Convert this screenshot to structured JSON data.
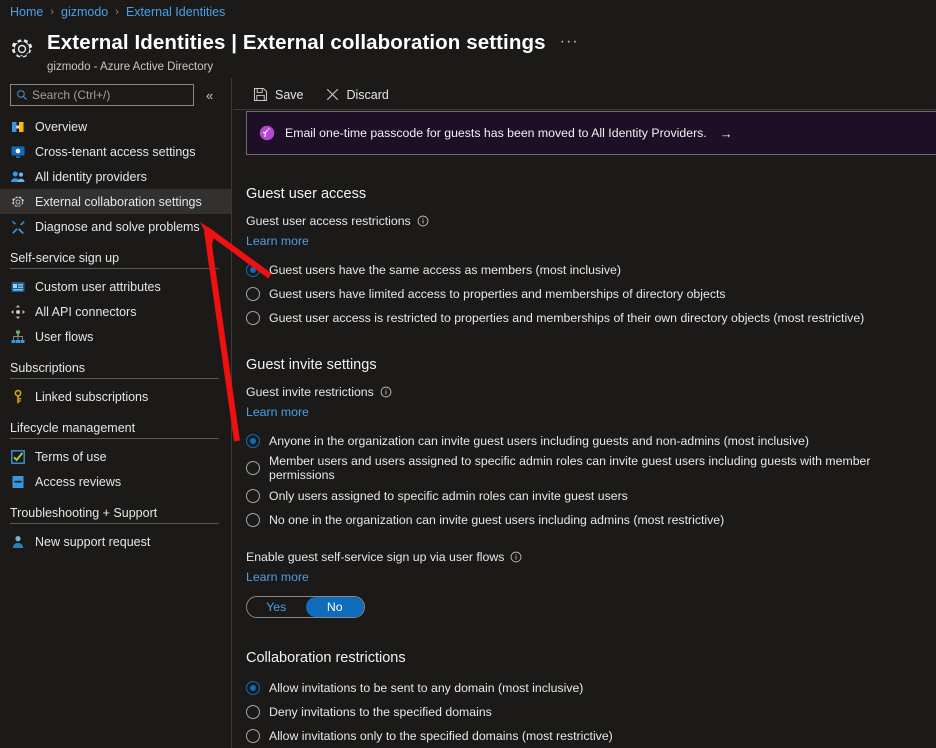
{
  "breadcrumb": {
    "items": [
      {
        "label": "Home"
      },
      {
        "label": "gizmodo"
      },
      {
        "label": "External Identities"
      }
    ],
    "separator": "›"
  },
  "header": {
    "icon": "gear-icon",
    "title": "External Identities | External collaboration settings",
    "subtitle": "gizmodo - Azure Active Directory",
    "more_label": "···"
  },
  "sidebar": {
    "search": {
      "placeholder": "Search (Ctrl+/)",
      "value": "",
      "icon": "search-icon"
    },
    "collapse_label": "«",
    "items": [
      {
        "label": "Overview",
        "icon": "overview-icon",
        "selected": false
      },
      {
        "label": "Cross-tenant access settings",
        "icon": "monitor-icon",
        "selected": false
      },
      {
        "label": "All identity providers",
        "icon": "people-icon",
        "selected": false
      },
      {
        "label": "External collaboration settings",
        "icon": "gear-icon",
        "selected": true
      },
      {
        "label": "Diagnose and solve problems",
        "icon": "wrench-icon",
        "selected": false
      }
    ],
    "groups": [
      {
        "title": "Self-service sign up",
        "items": [
          {
            "label": "Custom user attributes",
            "icon": "id-card-icon"
          },
          {
            "label": "All API connectors",
            "icon": "connector-icon"
          },
          {
            "label": "User flows",
            "icon": "flow-icon"
          }
        ]
      },
      {
        "title": "Subscriptions",
        "items": [
          {
            "label": "Linked subscriptions",
            "icon": "key-icon"
          }
        ]
      },
      {
        "title": "Lifecycle management",
        "items": [
          {
            "label": "Terms of use",
            "icon": "checkbox-icon"
          },
          {
            "label": "Access reviews",
            "icon": "book-icon"
          }
        ]
      },
      {
        "title": "Troubleshooting + Support",
        "items": [
          {
            "label": "New support request",
            "icon": "support-person-icon"
          }
        ]
      }
    ]
  },
  "toolbar": {
    "save_label": "Save",
    "discard_label": "Discard",
    "save_icon": "save-disk-icon",
    "discard_icon": "close-x-icon"
  },
  "banner": {
    "icon": "rocket-icon",
    "text": "Email one-time passcode for guests has been moved to All Identity Providers.",
    "arrow": "→",
    "background": "#1d0f26",
    "icon_color": "#b44ad0"
  },
  "guest_user_access": {
    "section_title": "Guest user access",
    "field_label": "Guest user access restrictions",
    "learn_more": "Learn more",
    "options": [
      {
        "label": "Guest users have the same access as members (most inclusive)",
        "checked": true
      },
      {
        "label": "Guest users have limited access to properties and memberships of directory objects",
        "checked": false
      },
      {
        "label": "Guest user access is restricted to properties and memberships of their own directory objects (most restrictive)",
        "checked": false
      }
    ]
  },
  "guest_invite_settings": {
    "section_title": "Guest invite settings",
    "field_label": "Guest invite restrictions",
    "learn_more": "Learn more",
    "options": [
      {
        "label": "Anyone in the organization can invite guest users including guests and non-admins (most inclusive)",
        "checked": true
      },
      {
        "label": "Member users and users assigned to specific admin roles can invite guest users including guests with member permissions",
        "checked": false
      },
      {
        "label": "Only users assigned to specific admin roles can invite guest users",
        "checked": false
      },
      {
        "label": "No one in the organization can invite guest users including admins (most restrictive)",
        "checked": false
      }
    ],
    "self_service": {
      "field_label": "Enable guest self-service sign up via user flows",
      "learn_more": "Learn more",
      "yes_label": "Yes",
      "no_label": "No",
      "value": "No"
    }
  },
  "collaboration_restrictions": {
    "section_title": "Collaboration restrictions",
    "options": [
      {
        "label": "Allow invitations to be sent to any domain (most inclusive)",
        "checked": true
      },
      {
        "label": "Deny invitations to the specified domains",
        "checked": false
      },
      {
        "label": "Allow invitations only to the specified domains (most restrictive)",
        "checked": false
      }
    ]
  },
  "annotation": {
    "color": "#ee1111",
    "shape": "arrow-pointing-to-external-collaboration-settings"
  },
  "colors": {
    "accent": "#0f6cbd",
    "link": "#4aa0e8",
    "background": "#1b1a19",
    "selected_row": "#323130"
  }
}
